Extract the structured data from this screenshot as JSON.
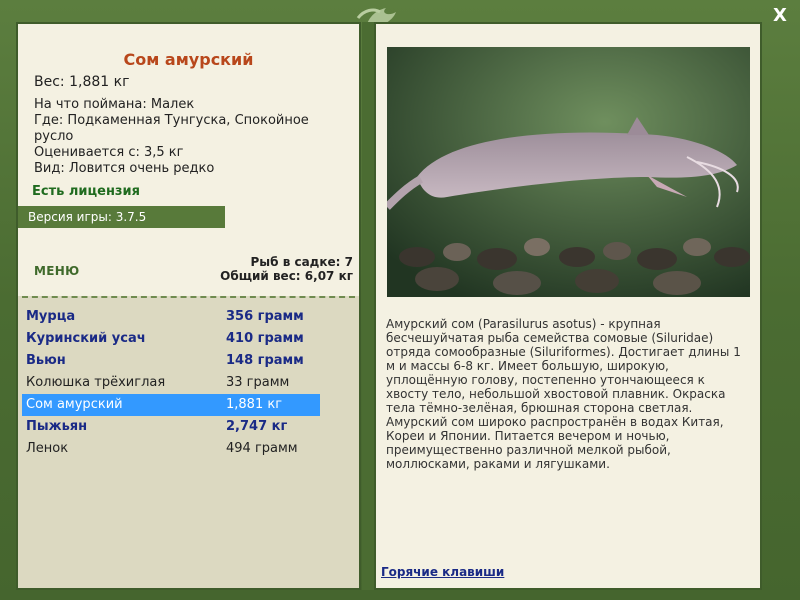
{
  "fish": {
    "title": "Сом амурский",
    "weight": "Вес: 1,881 кг",
    "caught_on": "На что поймана: Малек",
    "where": "Где: Подкаменная Тунгуска, Спокойное русло",
    "valued": "Оценивается с: 3,5 кг",
    "kind": "Вид: Ловится очень редко"
  },
  "license": "Есть лицензия",
  "version": "Версия игры: 3.7.5",
  "menu_label": "МЕНЮ",
  "keep": {
    "count": "Рыб в садке: 7",
    "total": "Общий вес: 6,07 кг"
  },
  "catch_list": [
    {
      "name": "Мурца",
      "weight": "356 грамм",
      "style": "bold"
    },
    {
      "name": "Куринский усач",
      "weight": "410 грамм",
      "style": "bold"
    },
    {
      "name": "Вьюн",
      "weight": "148 грамм",
      "style": "bold"
    },
    {
      "name": "Колюшка трёхиглая",
      "weight": "33 грамм",
      "style": "normal"
    },
    {
      "name": "Сом амурский",
      "weight": "1,881 кг",
      "style": "selected"
    },
    {
      "name": "Пыжьян",
      "weight": "2,747 кг",
      "style": "bold"
    },
    {
      "name": "Ленок",
      "weight": "494 грамм",
      "style": "normal"
    }
  ],
  "description": "Амурский сом (Parasilurus asotus) - крупная бесчешуйчатая рыба семейства сомовые (Siluridae) отряда сомообразные (Siluriformes). Достигает длины 1 м и массы 6-8 кг. Имеет большую, широкую, уплощённую голову, постепенно утончающееся к хвосту тело, небольшой хвостовой плавник. Окраска тела тёмно-зелёная, брюшная сторона светлая. Амурский сом широко распространён в водах Китая, Кореи и Японии. Питается вечером и ночью, преимущественно различной мелкой рыбой, моллюсками, раками и лягушками.",
  "hotkeys": "Горячие клавиши",
  "close": "X",
  "colors": {
    "frame": "#4b6c32",
    "title": "#b8471b",
    "selected": "#3399ff",
    "link": "#1a2a86"
  }
}
